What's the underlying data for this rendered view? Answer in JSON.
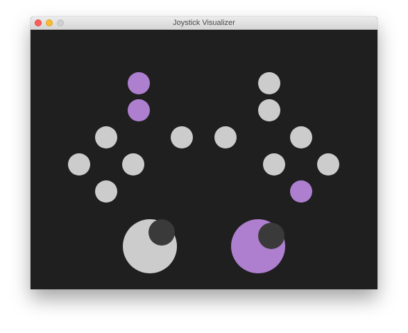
{
  "window": {
    "title": "Joystick Visualizer"
  },
  "colors": {
    "background": "#1f1f1f",
    "idle": "#cccccc",
    "pressed": "#ae7fcf",
    "stick_knob": "#3a3a3a"
  },
  "controller": {
    "left_shoulder": {
      "upper_pressed": true,
      "lower_pressed": true
    },
    "right_shoulder": {
      "upper_pressed": false,
      "lower_pressed": false
    },
    "left_dpad": {
      "up_pressed": false,
      "left_pressed": false,
      "right_pressed": false,
      "down_pressed": false
    },
    "center_buttons": {
      "left_pressed": false,
      "right_pressed": false
    },
    "right_face": {
      "top_pressed": false,
      "left_pressed": false,
      "right_pressed": false,
      "bottom_pressed": true
    },
    "left_stick": {
      "pressed": false
    },
    "right_stick": {
      "pressed": true
    }
  }
}
